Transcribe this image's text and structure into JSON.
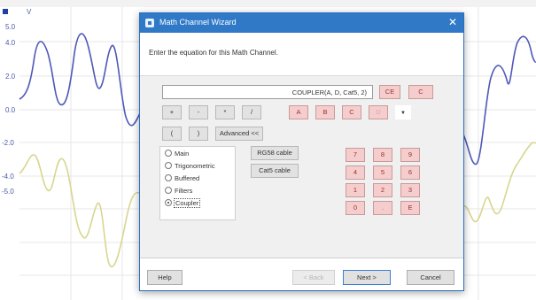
{
  "scope": {
    "unit_label": "V",
    "y_ticks": [
      "5.0",
      "4.0",
      "2.0",
      "0.0",
      "-2.0",
      "-4.0",
      "-5.0"
    ],
    "colors": {
      "channel_a": "#4e58b8",
      "channel_b": "#d8d68e",
      "grid": "#e7e7e7"
    }
  },
  "dialog": {
    "title": "Math Channel Wizard",
    "close_icon": "close-icon",
    "prompt": "Enter the equation for this Math Channel.",
    "equation": "COUPLER(A, D, Cat5, 2)",
    "clear_label": "CE",
    "c_label": "C",
    "operators": [
      "+",
      "-",
      "*",
      "/"
    ],
    "channels": [
      "A",
      "B",
      "C",
      "D"
    ],
    "parens": [
      "(",
      ")"
    ],
    "advanced_label": "Advanced <<",
    "categories": [
      {
        "label": "Main",
        "selected": false
      },
      {
        "label": "Trigonometric",
        "selected": false
      },
      {
        "label": "Buffered",
        "selected": false
      },
      {
        "label": "Filters",
        "selected": false
      },
      {
        "label": "Coupler",
        "selected": true
      }
    ],
    "coupler_buttons": [
      "RG58 cable",
      "Cat5 cable"
    ],
    "keypad": [
      "7",
      "8",
      "9",
      "4",
      "5",
      "6",
      "1",
      "2",
      "3",
      "0",
      ".",
      "E"
    ],
    "footer": {
      "help": "Help",
      "back": "< Back",
      "next": "Next >",
      "cancel": "Cancel"
    }
  }
}
